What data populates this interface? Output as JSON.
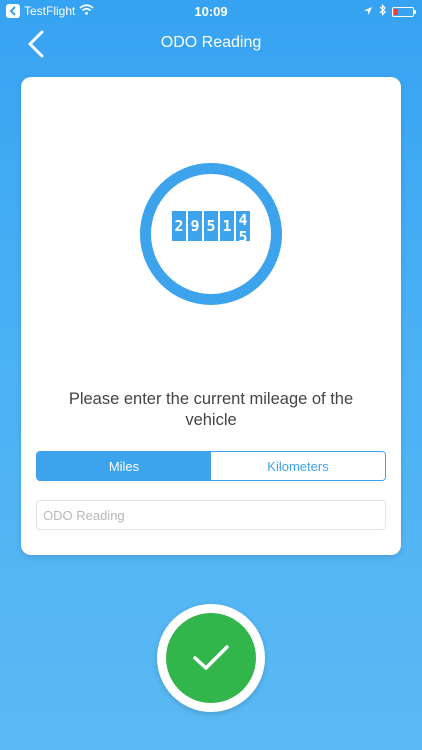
{
  "status_bar": {
    "carrier": "TestFlight",
    "time": "10:09",
    "battery_level": 0.2
  },
  "nav": {
    "title": "ODO Reading"
  },
  "odometer": {
    "digits": [
      "2",
      "9",
      "5",
      "1"
    ],
    "rolling_digit_top": "4",
    "rolling_digit_bottom": "5"
  },
  "prompt_text": "Please enter the current mileage of the vehicle",
  "units": {
    "miles_label": "Miles",
    "kilometers_label": "Kilometers",
    "selected": "Miles"
  },
  "input": {
    "placeholder": "ODO Reading",
    "value": ""
  },
  "colors": {
    "accent": "#3DA3EC",
    "confirm": "#32B64B"
  }
}
